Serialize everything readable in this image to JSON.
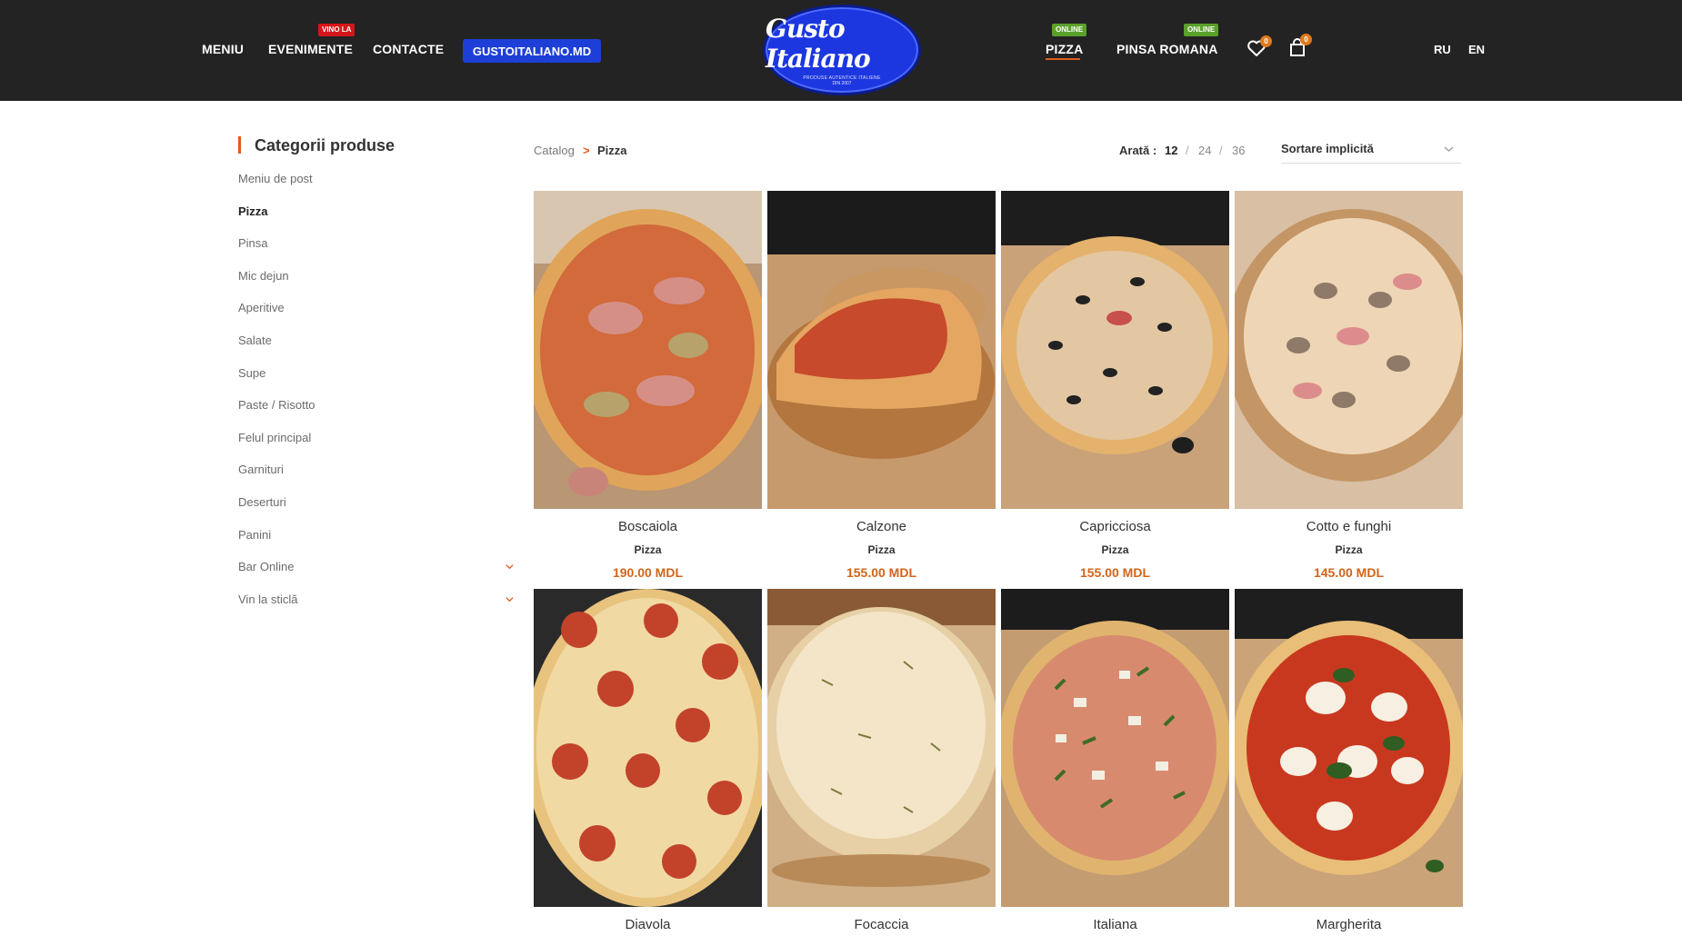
{
  "header": {
    "nav_left": [
      {
        "label": "MENIU"
      },
      {
        "label": "EVENIMENTE",
        "badge": "VINO LA"
      },
      {
        "label": "CONTACTE"
      }
    ],
    "site_button": "GUSTOITALIANO.MD",
    "logo": {
      "text": "Gusto Italiano",
      "tagline": "PRODUSE AUTENTICE ITALIENE",
      "since": "DIN 2007"
    },
    "nav_right": [
      {
        "label": "PIZZA",
        "badge": "ONLINE",
        "active": true
      },
      {
        "label": "PINSA ROMANA",
        "badge": "ONLINE",
        "active": false
      }
    ],
    "wishlist_count": "0",
    "cart_count": "0",
    "languages": [
      "RU",
      "EN"
    ],
    "colors": {
      "bar": "#232323",
      "accent": "#e05a1d",
      "button": "#1d3fd8",
      "badge_red": "#d4161b",
      "badge_green": "#5aa12b"
    }
  },
  "sidebar": {
    "title": "Categorii produse",
    "items": [
      {
        "label": "Meniu de post"
      },
      {
        "label": "Pizza",
        "active": true
      },
      {
        "label": "Pinsa"
      },
      {
        "label": "Mic dejun"
      },
      {
        "label": "Aperitive"
      },
      {
        "label": "Salate"
      },
      {
        "label": "Supe"
      },
      {
        "label": "Paste / Risotto"
      },
      {
        "label": "Felul principal"
      },
      {
        "label": "Garnituri"
      },
      {
        "label": "Deserturi"
      },
      {
        "label": "Panini"
      },
      {
        "label": "Bar Online",
        "expandable": true
      },
      {
        "label": "Vin la sticlă",
        "expandable": true
      }
    ]
  },
  "toolbar": {
    "breadcrumb": {
      "root": "Catalog",
      "separator": ">",
      "current": "Pizza"
    },
    "show_label": "Arată :",
    "per_page": [
      "12",
      "24",
      "36"
    ],
    "per_page_selected": "12",
    "sort_label": "Sortare implicită"
  },
  "products": [
    {
      "name": "Boscaiola",
      "category": "Pizza",
      "price": "190.00 MDL",
      "image": "pizza-ham-artichoke"
    },
    {
      "name": "Calzone",
      "category": "Pizza",
      "price": "155.00 MDL",
      "image": "calzone"
    },
    {
      "name": "Capricciosa",
      "category": "Pizza",
      "price": "155.00 MDL",
      "image": "pizza-olives"
    },
    {
      "name": "Cotto e funghi",
      "category": "Pizza",
      "price": "145.00 MDL",
      "image": "pizza-ham-mushroom"
    },
    {
      "name": "Diavola",
      "category": "",
      "price": "",
      "image": "pizza-pepperoni"
    },
    {
      "name": "Focaccia",
      "category": "",
      "price": "",
      "image": "focaccia"
    },
    {
      "name": "Italiana",
      "category": "",
      "price": "",
      "image": "pizza-rucola-parmesan"
    },
    {
      "name": "Margherita",
      "category": "",
      "price": "",
      "image": "pizza-margherita"
    }
  ]
}
